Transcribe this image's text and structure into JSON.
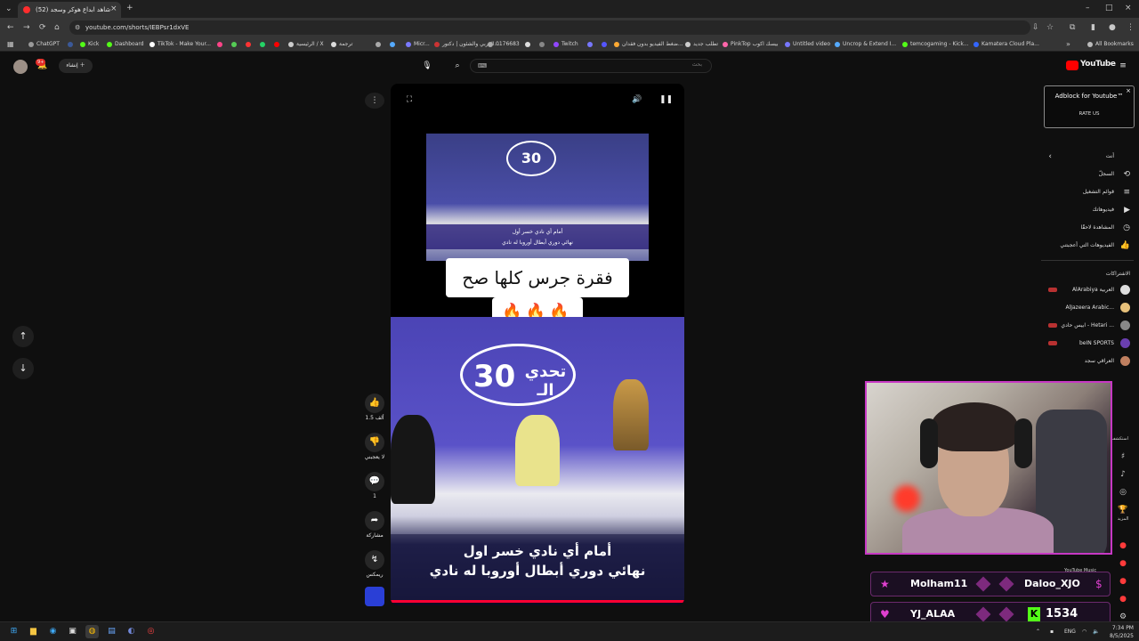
{
  "browser": {
    "tab_title": "(52) شاهد ابداع هوكر وسجد",
    "new_tab": "+",
    "url": "youtube.com/shorts/IEBPsr1dxVE",
    "bookmarks": [
      {
        "label": "ChatGPT",
        "color": "#9a9a9a"
      },
      {
        "label": "Kick",
        "color": "#53fc18"
      },
      {
        "label": "Dashboard",
        "color": "#53fc18"
      },
      {
        "label": "TikTok - Make Your...",
        "color": "#ffffff"
      },
      {
        "label": "الرئيسية / X",
        "color": "#cccccc"
      },
      {
        "label": "ترجمة",
        "color": "#dddddd"
      },
      {
        "label": "Micr...",
        "color": "#7a7aff"
      },
      {
        "label": "العربي والشئون | دكتور...",
        "color": "#cc3333"
      },
      {
        "label": "0176683",
        "color": "#aaaaaa"
      },
      {
        "label": "Twitch",
        "color": "#9146ff"
      },
      {
        "label": "ضغط الفيديو بدون فقدان...",
        "color": "#ffaa33"
      },
      {
        "label": "تطلب جديد",
        "color": "#cccccc"
      },
      {
        "label": "PinkTop بيسك اكوب",
        "color": "#ff66aa"
      },
      {
        "label": "Untitled video",
        "color": "#7777ff"
      },
      {
        "label": "Uncrop & Extend I...",
        "color": "#55aaff"
      },
      {
        "label": "temcogaming - Kick...",
        "color": "#53fc18"
      },
      {
        "label": "Kamatera Cloud Pla...",
        "color": "#3366ff"
      }
    ],
    "all_bookmarks": "All Bookmarks"
  },
  "youtube": {
    "logo": "YouTube",
    "create_label": "إنشاء",
    "notif_count": "9+",
    "search_placeholder": "بحث",
    "adblock_title": "Adblock for Youtube™",
    "adblock_rate": "RATE US",
    "you_label": "أنت",
    "nav": [
      {
        "label": "السجلّ",
        "icon": "⟲"
      },
      {
        "label": "قوائم التشغيل",
        "icon": "≡"
      },
      {
        "label": "فيديوهاتك",
        "icon": "▶"
      },
      {
        "label": "المشاهدة لاحقًا",
        "icon": "◷"
      },
      {
        "label": "الفيديوهات التي أعجبتني",
        "icon": "👍"
      }
    ],
    "subs_label": "الاشتراكات",
    "subs": [
      {
        "label": "AlArabiya العربية",
        "color": "#dddddd"
      },
      {
        "label": "AlJazeera Arabic...",
        "color": "#e6c07a"
      },
      {
        "label": "ابيس حادي - Hetari ...",
        "color": "#888888"
      },
      {
        "label": "beIN SPORTS",
        "color": "#6a3fb0"
      },
      {
        "label": "العراقي سجد",
        "color": "#c08060"
      }
    ],
    "more_label": "المزيد",
    "explore_label": "استكشف",
    "ytmusic": "YouTube Music"
  },
  "short": {
    "caption": "فقرة جرس كلها صح",
    "emoji": "🔥🔥🔥",
    "top_overlay": "أمام أي نادي خسر أول",
    "top_overlay2": "نهائي دوري أبطال أوروبا له نادي",
    "sub_line1": "أمام أي نادي خسر اول",
    "sub_line2": "نهائي دوري أبطال أوروبا له نادي",
    "badge_num": "30",
    "badge_text": "تحدي الـ",
    "likes": "1.5 ألف",
    "dislike": "لا يعجبني",
    "comments": "1",
    "share": "مشاركة",
    "remix": "ريمكس"
  },
  "chat": {
    "row1_left": "Molham11",
    "row1_right": "Daloo_XJO",
    "row2_left": "YJ_ALAA",
    "row2_right": "1534"
  },
  "taskbar": {
    "lang": "ENG",
    "time": "7:34 PM",
    "date": "8/5/2025"
  }
}
